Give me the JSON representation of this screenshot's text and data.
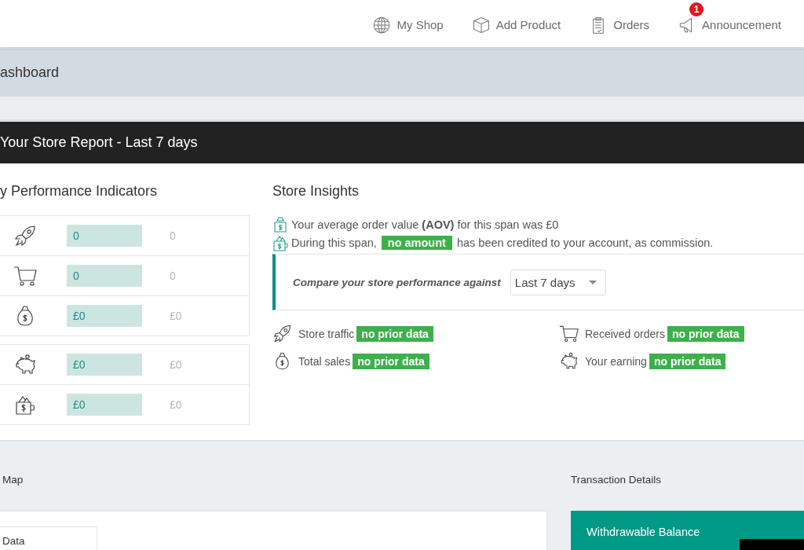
{
  "topbar": {
    "nav": [
      {
        "kind": "globe",
        "label": "My Shop"
      },
      {
        "kind": "box",
        "label": "Add Product"
      },
      {
        "kind": "clipboard",
        "label": "Orders"
      },
      {
        "kind": "megaphone",
        "label": "Announcement",
        "badge": "1"
      }
    ]
  },
  "breadcrumb": {
    "title": "ashboard"
  },
  "report": {
    "title": "Your Store Report - Last 7 days"
  },
  "kpi": {
    "title": "y Performance Indicators",
    "groups": [
      [
        {
          "kind": "traffic",
          "value": "0",
          "previous": "0"
        },
        {
          "kind": "orders",
          "value": "0",
          "previous": "0"
        },
        {
          "kind": "sales",
          "value": "£0",
          "previous": "£0"
        }
      ],
      [
        {
          "kind": "earning",
          "value": "£0",
          "previous": "£0"
        },
        {
          "kind": "commission",
          "value": "£0",
          "previous": "£0"
        }
      ]
    ]
  },
  "insights": {
    "title": "Store Insights",
    "lines": [
      {
        "kind": "aov",
        "text": "Your average order value **(AOV)** for this span was £0"
      },
      {
        "kind": "commission",
        "before": "During this span,",
        "highlight": "no amount",
        "after": "has been credited to your account, as commission."
      }
    ],
    "compare": {
      "label": "Compare your store performance against",
      "select": "Last 7 days"
    },
    "comparisons": [
      {
        "kind": "traffic",
        "label": "Store traffic",
        "status": "no prior data"
      },
      {
        "kind": "orders",
        "label": "Received orders",
        "status": "no prior data"
      },
      {
        "kind": "sales",
        "label": "Total sales",
        "status": "no prior data"
      },
      {
        "kind": "earning",
        "label": "Your earning",
        "status": "no prior data"
      }
    ]
  },
  "map": {
    "title": "Map",
    "legend": "Data"
  },
  "transactions": {
    "title": "Transaction Details",
    "card": {
      "label": "Withdrawable Balance"
    }
  }
}
